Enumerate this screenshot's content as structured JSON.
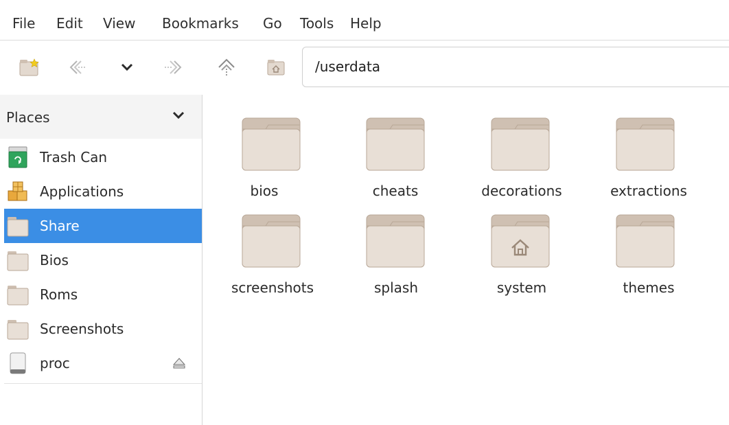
{
  "menubar": {
    "items": [
      "File",
      "Edit",
      "View",
      "Bookmarks",
      "Go",
      "Tools",
      "Help"
    ]
  },
  "toolbar": {
    "address": "/userdata",
    "icons": [
      "new-folder-icon",
      "back-icon",
      "history-dropdown-icon",
      "forward-icon",
      "up-icon",
      "home-icon"
    ]
  },
  "sidebar": {
    "header": "Places",
    "items": [
      {
        "label": "Trash Can",
        "icon": "trash-icon"
      },
      {
        "label": "Applications",
        "icon": "applications-icon"
      },
      {
        "label": "Share",
        "icon": "folder-icon",
        "selected": true
      },
      {
        "label": "Bios",
        "icon": "folder-icon"
      },
      {
        "label": "Roms",
        "icon": "folder-icon"
      },
      {
        "label": "Screenshots",
        "icon": "folder-icon"
      },
      {
        "label": "proc",
        "icon": "drive-icon",
        "eject": true
      }
    ]
  },
  "content": {
    "folders": [
      {
        "label": "bios"
      },
      {
        "label": "cheats"
      },
      {
        "label": "decorations"
      },
      {
        "label": "extractions"
      },
      {
        "label": "screenshots"
      },
      {
        "label": "splash"
      },
      {
        "label": "system",
        "home_badge": true
      },
      {
        "label": "themes"
      }
    ]
  },
  "colors": {
    "selection": "#3b8ee5",
    "folder_body": "#e8dfd6",
    "folder_tab": "#cfc0b2",
    "folder_border": "#b8a797"
  }
}
